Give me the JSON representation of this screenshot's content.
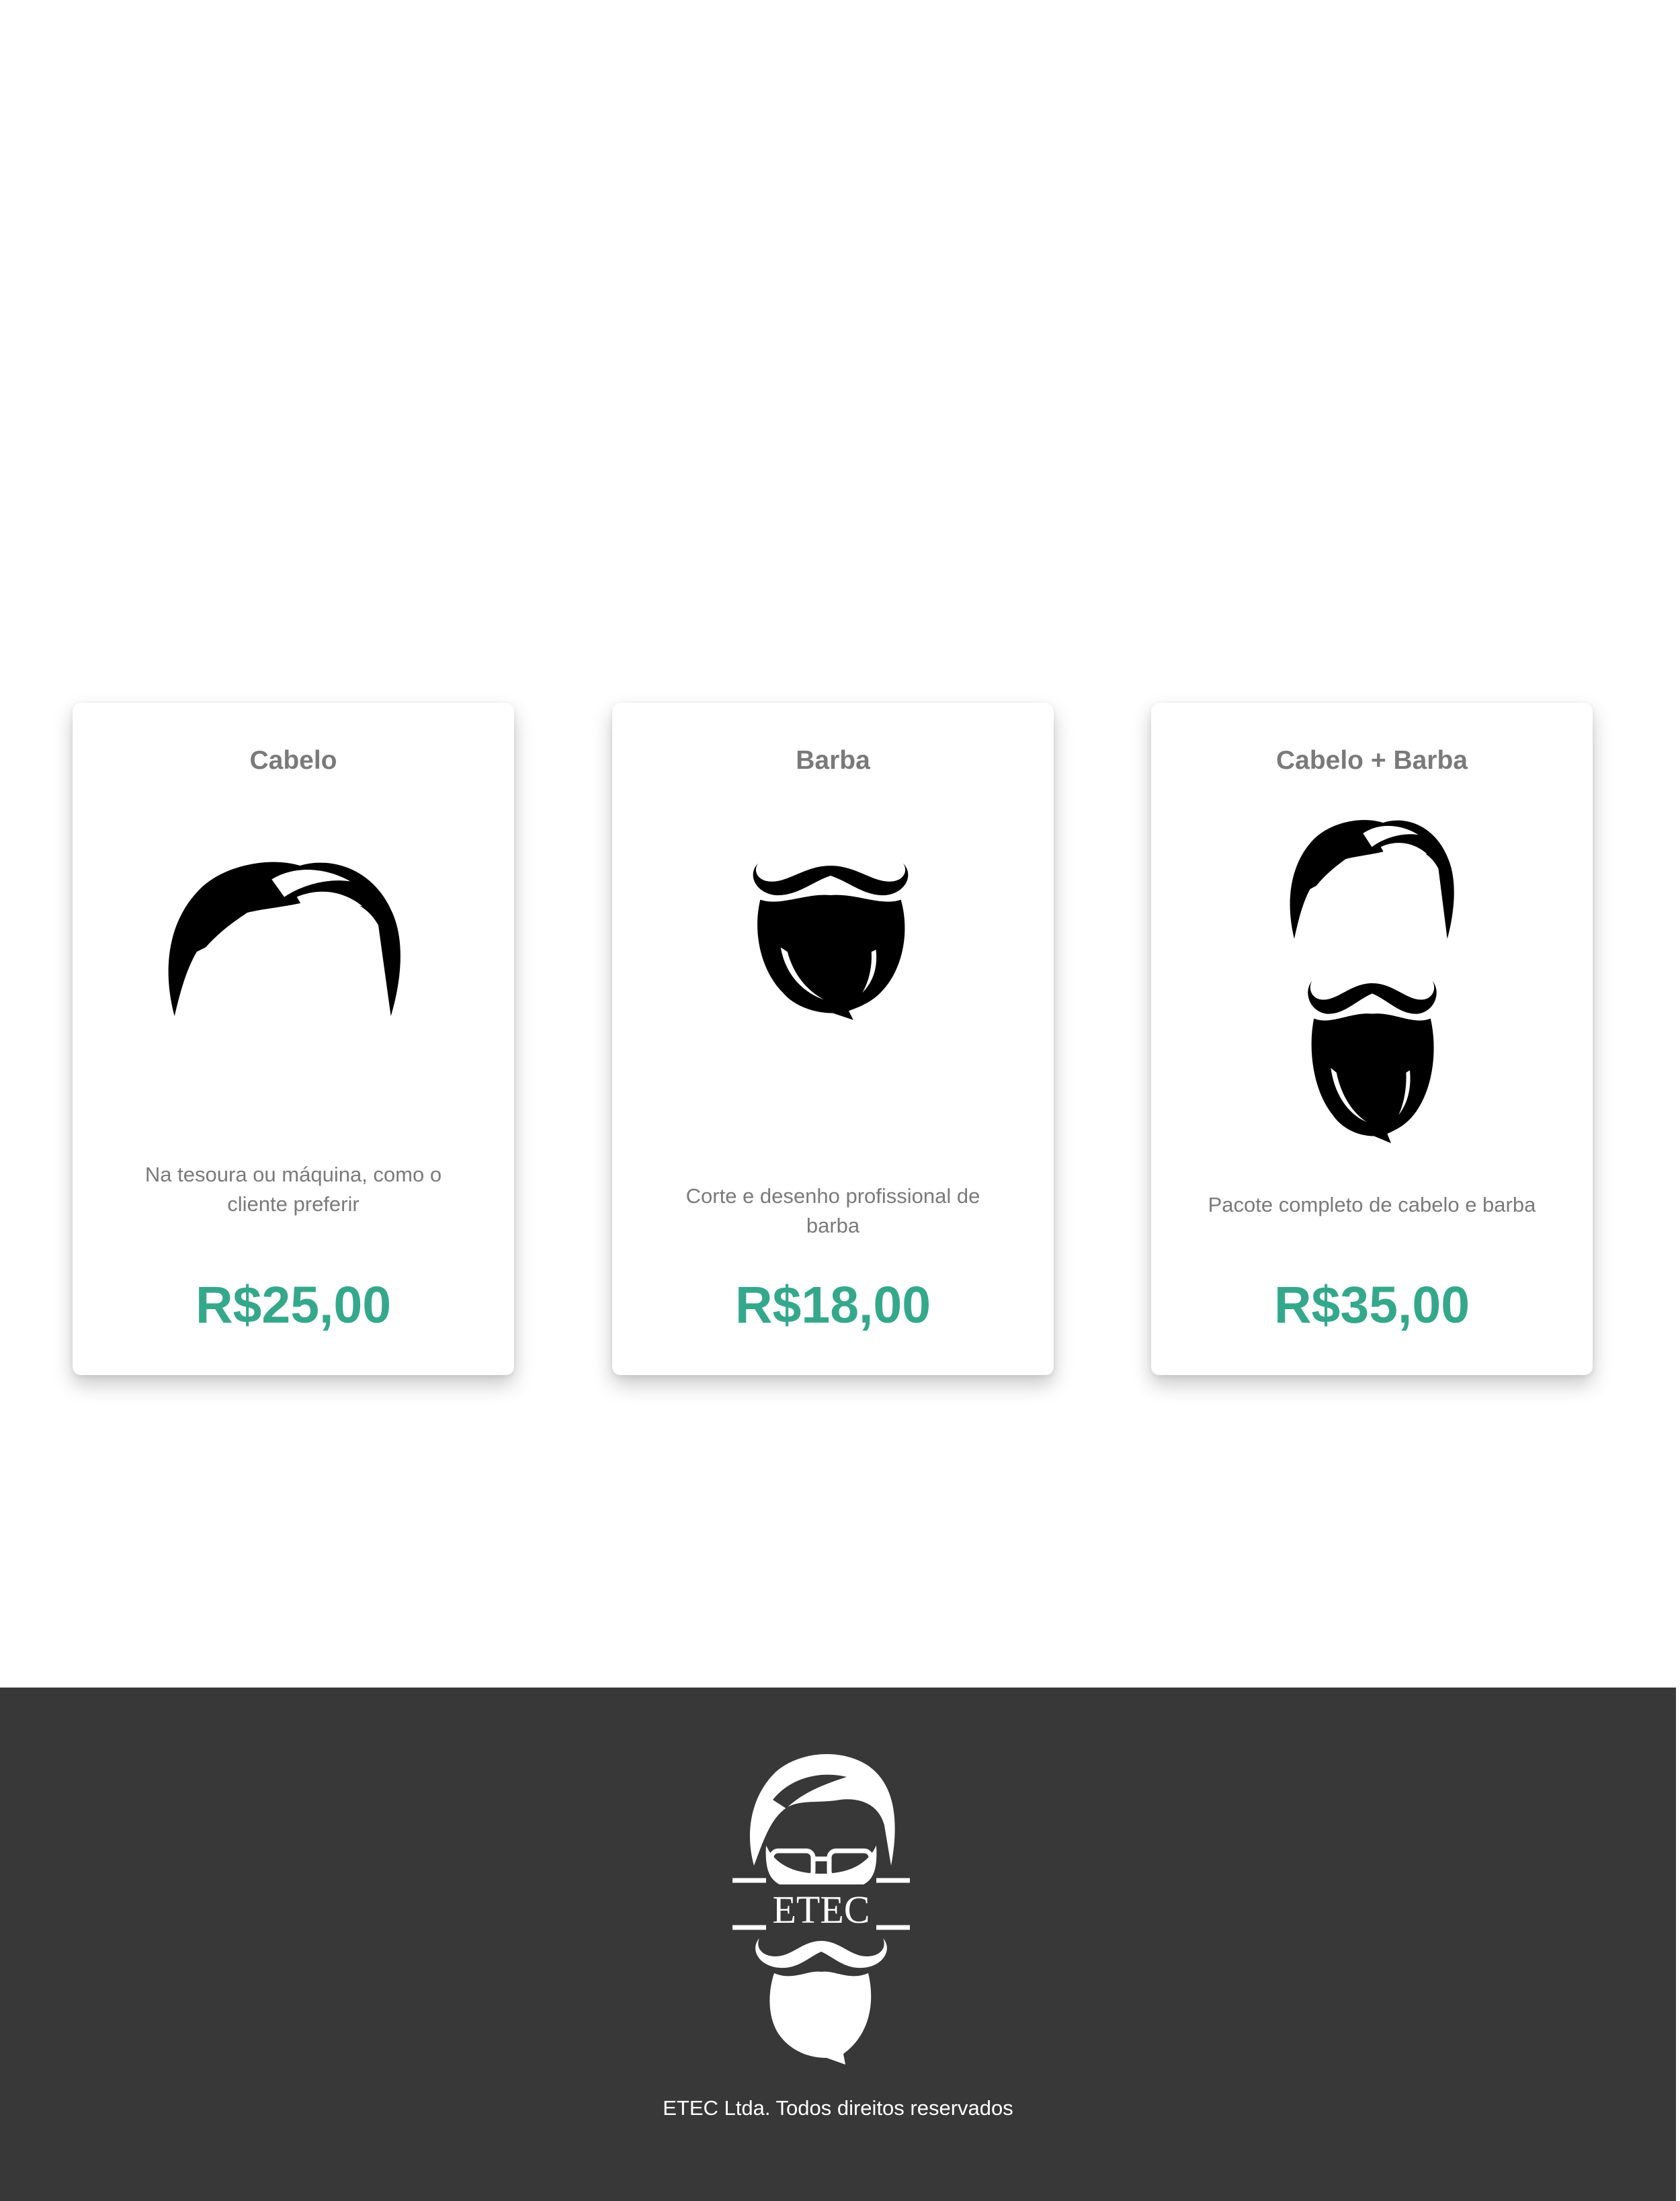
{
  "services": [
    {
      "title": "Cabelo",
      "description": "Na tesoura ou máquina, como o cliente preferir",
      "price": "R$25,00",
      "illustration": "hair-icon"
    },
    {
      "title": "Barba",
      "description": "Corte e desenho profissional de barba",
      "price": "R$18,00",
      "illustration": "beard-icon"
    },
    {
      "title": "Cabelo + Barba",
      "description": "Pacote completo de cabelo e barba",
      "price": "R$35,00",
      "illustration": "hair-and-beard-icon"
    }
  ],
  "footer": {
    "logo_text": "ETEC",
    "copyright": "ETEC Ltda. Todos direitos reservados"
  },
  "colors": {
    "price": "#35a88c",
    "muted_text": "#7a7a7a",
    "footer_background": "#383838"
  }
}
